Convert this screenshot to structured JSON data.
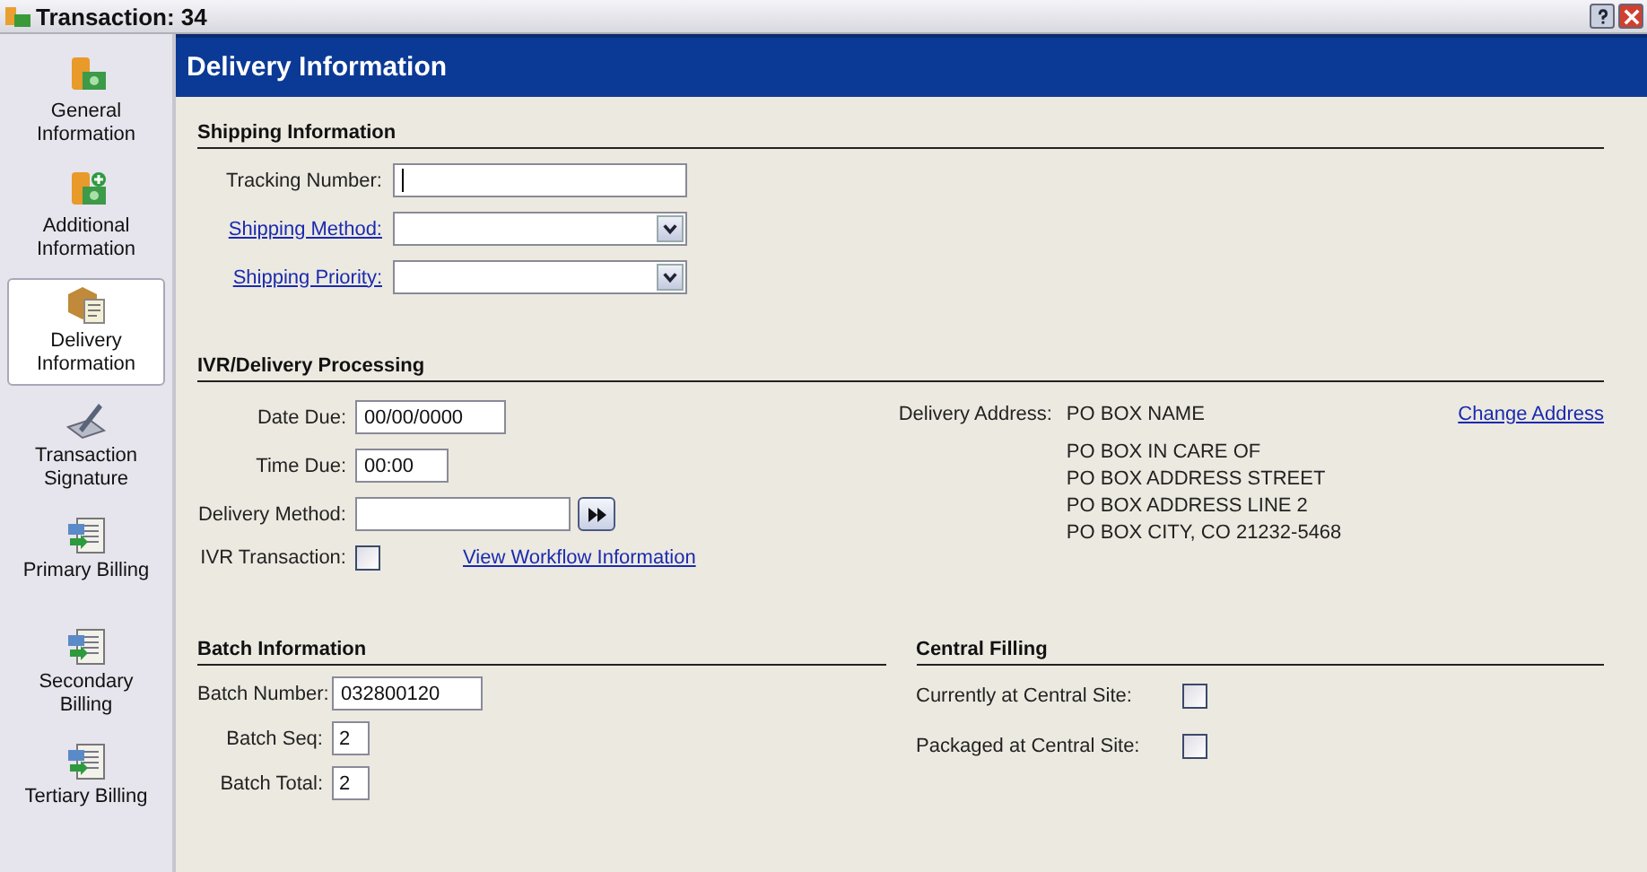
{
  "window": {
    "title": "Transaction: 34"
  },
  "sidebar": {
    "items": [
      {
        "label": "General Information",
        "selected": false
      },
      {
        "label": "Additional Information",
        "selected": false
      },
      {
        "label": "Delivery Information",
        "selected": true
      },
      {
        "label": "Transaction Signature",
        "selected": false
      },
      {
        "label": "Primary Billing",
        "selected": false
      },
      {
        "label": "Secondary Billing",
        "selected": false
      },
      {
        "label": "Tertiary Billing",
        "selected": false
      }
    ]
  },
  "header": "Delivery Information",
  "shipping": {
    "title": "Shipping Information",
    "tracking_number": {
      "label": "Tracking Number:"
    },
    "shipping_method": {
      "label": "Shipping Method:"
    },
    "shipping_priority": {
      "label": "Shipping Priority:"
    }
  },
  "ivr": {
    "title": "IVR/Delivery Processing",
    "date_due": {
      "label": "Date Due:",
      "value": "00/00/0000"
    },
    "time_due": {
      "label": "Time Due:",
      "value": "00:00"
    },
    "delivery_method": {
      "label": "Delivery Method:"
    },
    "ivr_transaction": {
      "label": "IVR Transaction:",
      "checked": false
    },
    "workflow_link": "View Workflow Information",
    "address_label": "Delivery Address:",
    "address_lines": [
      "PO BOX NAME",
      "PO BOX IN CARE OF",
      "PO BOX ADDRESS STREET",
      "PO BOX ADDRESS LINE 2",
      "PO BOX CITY, CO  21232-5468"
    ],
    "change_address": "Change Address"
  },
  "batch": {
    "title": "Batch Information",
    "fields": [
      {
        "label": "Batch Number:",
        "value": "032800120"
      },
      {
        "label": "Batch Seq:",
        "value": "2"
      },
      {
        "label": "Batch Total:",
        "value": "2"
      }
    ]
  },
  "central": {
    "title": "Central Filling",
    "items": [
      {
        "label": "Currently at Central Site:",
        "checked": false
      },
      {
        "label": "Packaged at Central Site:",
        "checked": false
      }
    ]
  }
}
